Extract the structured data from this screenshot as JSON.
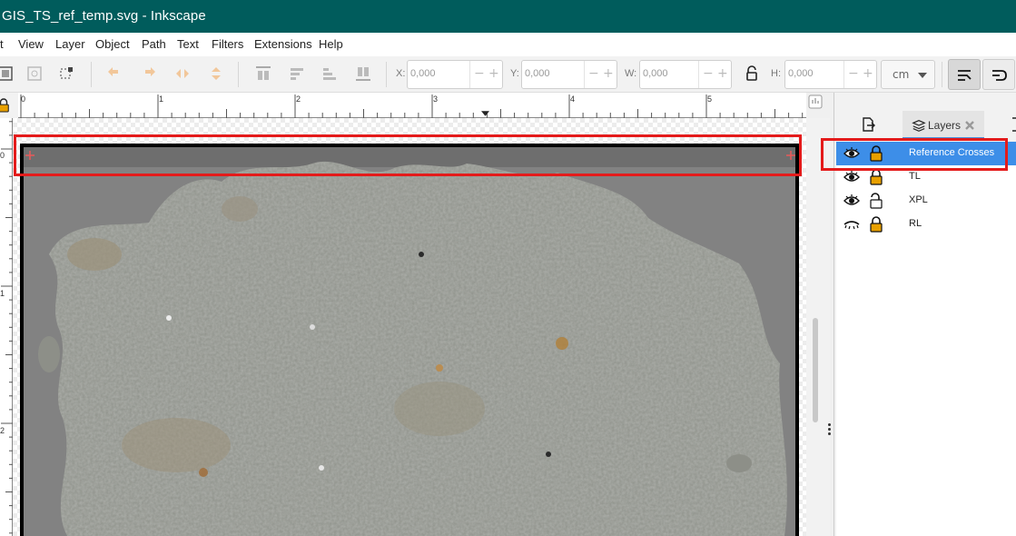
{
  "window": {
    "title": "GIS_TS_ref_temp.svg - Inkscape"
  },
  "menu": [
    "t",
    "View",
    "Layer",
    "Object",
    "Path",
    "Text",
    "Filters",
    "Extensions",
    "Help"
  ],
  "toolbar": {
    "x_label": "X:",
    "x_value": "0,000",
    "y_label": "Y:",
    "y_value": "0,000",
    "w_label": "W:",
    "w_value": "0,000",
    "h_label": "H:",
    "h_value": "0,000",
    "unit": "cm"
  },
  "rulers": {
    "horizontal_labels": [
      "0",
      "1",
      "2",
      "3",
      "4",
      "5"
    ],
    "vertical_labels": [
      "0",
      "1",
      "2"
    ]
  },
  "panel": {
    "tab_label": "Layers",
    "layers": [
      {
        "name": "Reference Crosses",
        "visible": true,
        "locked": true,
        "selected": true
      },
      {
        "name": "TL",
        "visible": true,
        "locked": true,
        "selected": false
      },
      {
        "name": "XPL",
        "visible": true,
        "locked": false,
        "selected": false
      },
      {
        "name": "RL",
        "visible": false,
        "locked": true,
        "selected": false
      }
    ]
  },
  "colors": {
    "titlebar": "#005c5c",
    "highlight": "#e41b1b",
    "selected_row": "#3d8ee8",
    "lock_icon": "#e8a000",
    "cross_marker": "#e85a5a",
    "image_background": "#828282"
  },
  "icons": [
    "align-icon",
    "transform-icon",
    "lock-ratio-icon",
    "snap-icon",
    "layers-icon",
    "close-icon",
    "eye-icon",
    "eye-closed-icon",
    "lock-icon",
    "unlock-icon"
  ]
}
